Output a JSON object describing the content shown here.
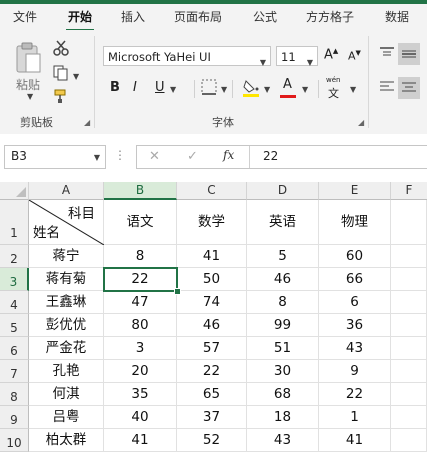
{
  "ribbon_tabs": [
    "文件",
    "开始",
    "插入",
    "页面布局",
    "公式",
    "方方格子",
    "数据"
  ],
  "active_tab": "开始",
  "ribbon": {
    "paste_label": "粘贴",
    "clipboard_group": "剪贴板",
    "font_group": "字体",
    "font_name": "Microsoft YaHei UI",
    "font_size": "11",
    "bold": "B",
    "italic": "I",
    "underline": "U",
    "font_color_glyph": "A",
    "phonetic_glyph": "文",
    "phonetic_small": "wén"
  },
  "formula_bar": {
    "name_box": "B3",
    "fx": "fx",
    "value": "22"
  },
  "columns": [
    "A",
    "B",
    "C",
    "D",
    "E",
    "F"
  ],
  "rows": [
    "1",
    "2",
    "3",
    "4",
    "5",
    "6",
    "7",
    "8",
    "9",
    "10"
  ],
  "header_cell": {
    "top_right": "科目",
    "bottom_left": "姓名"
  },
  "subjects": [
    "语文",
    "数学",
    "英语",
    "物理"
  ],
  "students": [
    {
      "name": "蒋宁",
      "scores": [
        "8",
        "41",
        "5",
        "60"
      ]
    },
    {
      "name": "蒋有菊",
      "scores": [
        "22",
        "50",
        "46",
        "66"
      ]
    },
    {
      "name": "王鑫琳",
      "scores": [
        "47",
        "74",
        "8",
        "6"
      ]
    },
    {
      "name": "彭优优",
      "scores": [
        "80",
        "46",
        "99",
        "36"
      ]
    },
    {
      "name": "严金花",
      "scores": [
        "3",
        "57",
        "51",
        "43"
      ]
    },
    {
      "name": "孔艳",
      "scores": [
        "20",
        "22",
        "30",
        "9"
      ]
    },
    {
      "name": "何淇",
      "scores": [
        "35",
        "65",
        "68",
        "22"
      ]
    },
    {
      "name": "吕粤",
      "scores": [
        "40",
        "37",
        "18",
        "1"
      ]
    },
    {
      "name": "柏太群",
      "scores": [
        "41",
        "52",
        "43",
        "41"
      ]
    }
  ],
  "selected_cell": "B3",
  "colors": {
    "accent": "#217346",
    "highlight_yellow": "#ffe600",
    "font_red": "#e01a1a"
  }
}
